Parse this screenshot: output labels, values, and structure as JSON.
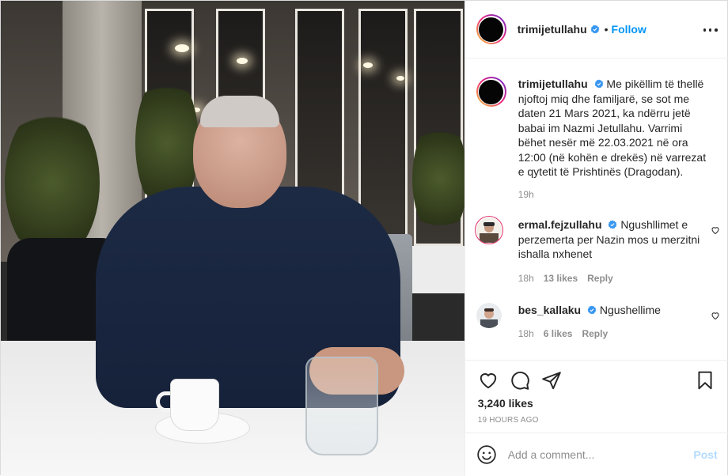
{
  "post": {
    "author": "trimijetullahu",
    "follow_label": "Follow",
    "separator": "•",
    "caption": "Me pikëllim të thellë njoftoj miq dhe familjarë, se sot me daten 21 Mars 2021, ka ndërru jetë babai im Nazmi Jetullahu. Varrimi bëhet nesër më 22.03.2021 në ora 12:00 (në kohën e drekës) në varrezat e qytetit të Prishtinës (Dragodan).",
    "caption_time": "19h"
  },
  "comments": [
    {
      "username": "ermal.fejzullahu",
      "text": "Ngushllimet e perzemerta per Nazin mos u merzitni ishalla nxhenet",
      "time": "18h",
      "likes": "13 likes",
      "reply_label": "Reply"
    },
    {
      "username": "bes_kallaku",
      "text": "Ngushellime",
      "time": "18h",
      "likes": "6 likes",
      "reply_label": "Reply"
    }
  ],
  "actions": {
    "likes_count": "3,240 likes",
    "post_age": "19 HOURS AGO"
  },
  "composer": {
    "placeholder": "Add a comment...",
    "post_label": "Post"
  },
  "colors": {
    "link_blue": "#0095f6",
    "verified_blue": "#3897f0",
    "muted": "#8e8e8e",
    "post_disabled": "#b3dbff"
  },
  "icons": [
    "verified-badge-icon",
    "more-options-icon",
    "heart-icon",
    "comment-icon",
    "share-icon",
    "bookmark-icon",
    "emoji-icon"
  ]
}
